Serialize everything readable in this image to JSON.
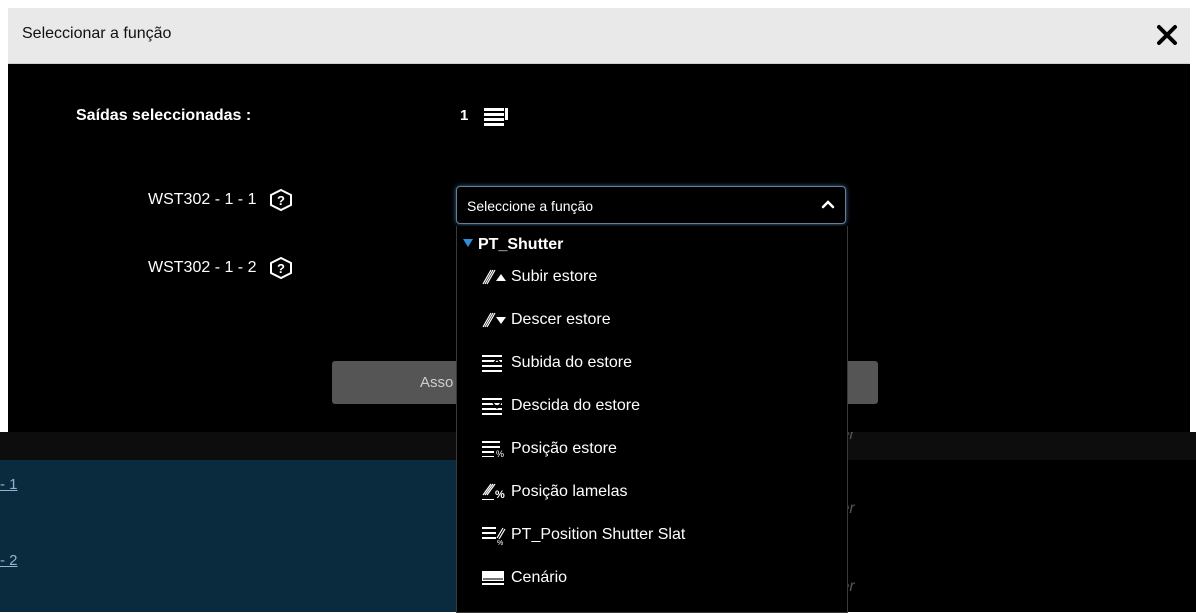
{
  "background": {
    "rows": [
      {
        "link": "- 1",
        "ghost": "ter"
      },
      {
        "link": "- 2",
        "ghost": "ter"
      }
    ],
    "top_ghost": "ter"
  },
  "modal": {
    "title": "Seleccionar a função",
    "selected_label": "Saídas seleccionadas :",
    "selected_count": "1",
    "outputs": [
      {
        "name": "WST302 - 1 - 1"
      },
      {
        "name": "WST302 - 1 - 2"
      }
    ],
    "select": {
      "value": "Seleccione a função",
      "group": "PT_Shutter",
      "options": [
        {
          "label": "Subir estore",
          "icon": "shutter-up-icon"
        },
        {
          "label": "Descer estore",
          "icon": "shutter-down-icon"
        },
        {
          "label": "Subida do estore",
          "icon": "shutter-raise-icon"
        },
        {
          "label": "Descida do estore",
          "icon": "shutter-lower-icon"
        },
        {
          "label": "Posição estore",
          "icon": "shutter-position-icon"
        },
        {
          "label": "Posição lamelas",
          "icon": "slat-position-icon"
        },
        {
          "label": "PT_Position Shutter Slat",
          "icon": "shutter-slat-position-icon"
        },
        {
          "label": "Cenário",
          "icon": "scene-icon"
        }
      ]
    },
    "assoc_button": "Asso"
  },
  "colors": {
    "accent": "#2f8fd8",
    "header_bg": "#e9e9e9",
    "row_bg": "#0a2a3e"
  }
}
